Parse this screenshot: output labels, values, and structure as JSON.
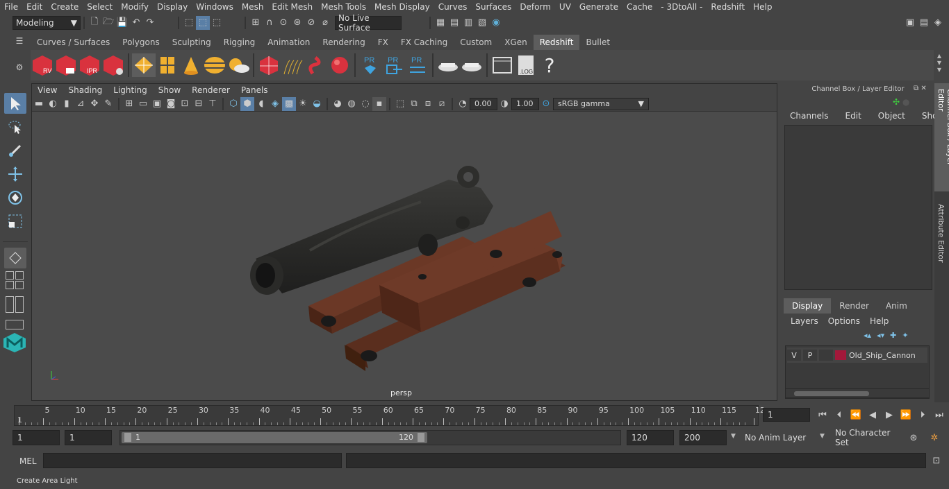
{
  "menubar": [
    "File",
    "Edit",
    "Create",
    "Select",
    "Modify",
    "Display",
    "Windows",
    "Mesh",
    "Edit Mesh",
    "Mesh Tools",
    "Mesh Display",
    "Curves",
    "Surfaces",
    "Deform",
    "UV",
    "Generate",
    "Cache",
    "- 3DtoAll -",
    "Redshift",
    "Help"
  ],
  "statusline": {
    "mode": "Modeling",
    "live_surface": "No Live Surface"
  },
  "shelf_tabs": [
    "Curves / Surfaces",
    "Polygons",
    "Sculpting",
    "Rigging",
    "Animation",
    "Rendering",
    "FX",
    "FX Caching",
    "Custom",
    "XGen",
    "Redshift",
    "Bullet"
  ],
  "active_shelf_tab": "Redshift",
  "shelf_icons": {
    "rv": "RV",
    "ipr": "IPR",
    "pr": "PR",
    "log": ".LOG",
    "help": "?"
  },
  "viewport": {
    "menus": [
      "View",
      "Shading",
      "Lighting",
      "Show",
      "Renderer",
      "Panels"
    ],
    "exposure": "0.00",
    "gamma": "1.00",
    "color_space": "sRGB gamma",
    "camera": "persp"
  },
  "channel_box": {
    "title": "Channel Box / Layer Editor",
    "menus": [
      "Channels",
      "Edit",
      "Object",
      "Show"
    ],
    "layer_tabs": [
      "Display",
      "Render",
      "Anim"
    ],
    "active_layer_tab": "Display",
    "layer_menus": [
      "Layers",
      "Options",
      "Help"
    ],
    "layers": [
      {
        "v": "V",
        "p": "P",
        "name": "Old_Ship_Cannon",
        "color": "#a3183a"
      }
    ]
  },
  "side_tabs": [
    "Channel Box / Layer Editor",
    "Attribute Editor"
  ],
  "timeline": {
    "labels": [
      "1",
      "5",
      "10",
      "15",
      "20",
      "25",
      "30",
      "35",
      "40",
      "45",
      "50",
      "55",
      "60",
      "65",
      "70",
      "75",
      "80",
      "85",
      "90",
      "95",
      "100",
      "105",
      "110",
      "115",
      "12"
    ],
    "current_frame": "1"
  },
  "range": {
    "start": "1",
    "playback_start": "1",
    "slider_start": "1",
    "slider_end": "120",
    "playback_end": "120",
    "end": "200",
    "anim_layer": "No Anim Layer",
    "character_set": "No Character Set"
  },
  "mel": {
    "label": "MEL"
  },
  "help_line": "Create Area Light"
}
